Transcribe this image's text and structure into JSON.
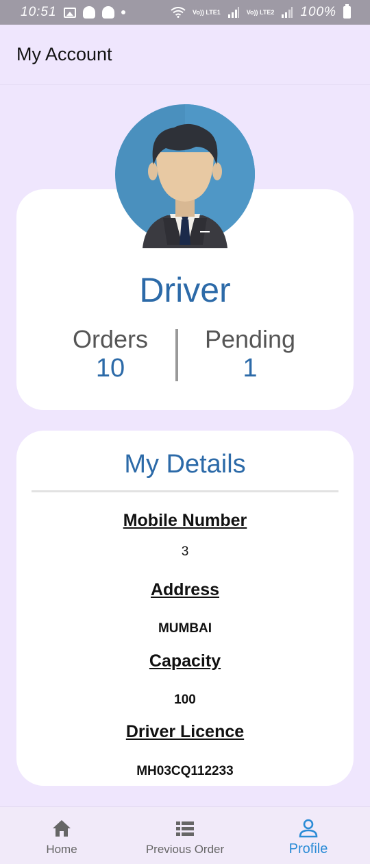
{
  "status_bar": {
    "time": "10:51",
    "lte1": "Vo)) LTE1",
    "lte2": "Vo)) LTE2",
    "battery": "100%"
  },
  "app_bar": {
    "title": "My Account"
  },
  "profile": {
    "role": "Driver",
    "orders_label": "Orders",
    "orders_value": "10",
    "pending_label": "Pending",
    "pending_value": "1"
  },
  "details": {
    "title": "My Details",
    "fields": [
      {
        "label": "Mobile Number",
        "value": "3"
      },
      {
        "label": "Address",
        "value": "MUMBAI"
      },
      {
        "label": "Capacity",
        "value": "100"
      },
      {
        "label": "Driver Licence",
        "value": "MH03CQ112233"
      }
    ]
  },
  "bottom_nav": {
    "items": [
      {
        "label": "Home",
        "icon": "home-icon",
        "active": false
      },
      {
        "label": "Previous Order",
        "icon": "list-icon",
        "active": false
      },
      {
        "label": "Profile",
        "icon": "person-icon",
        "active": true
      }
    ]
  },
  "colors": {
    "background": "#efe6fd",
    "accent_blue": "#2c6aa8",
    "active_nav": "#2a8bd6"
  }
}
